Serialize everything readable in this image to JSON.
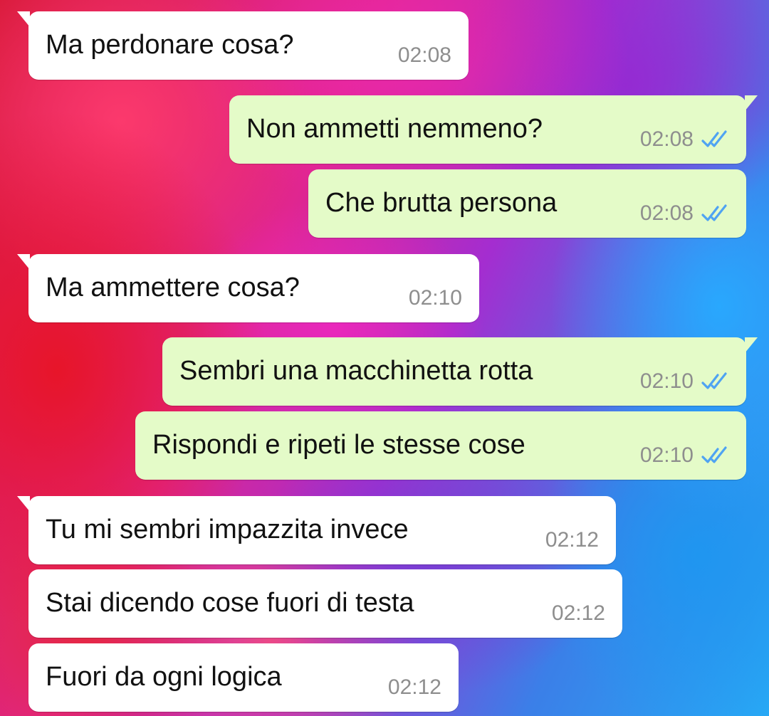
{
  "colors": {
    "incoming_bubble": "#ffffff",
    "outgoing_bubble": "#e4fbc8",
    "message_text": "#111111",
    "timestamp_text": "#8e8e8e",
    "read_receipt": "#4fa3f2"
  },
  "messages": [
    {
      "direction": "incoming",
      "text": "Ma perdonare cosa?",
      "time": "02:08"
    },
    {
      "direction": "outgoing",
      "text": "Non ammetti nemmeno?",
      "time": "02:08",
      "status_icon": "double-check-read-icon"
    },
    {
      "direction": "outgoing",
      "text": "Che brutta persona",
      "time": "02:08",
      "status_icon": "double-check-read-icon"
    },
    {
      "direction": "incoming",
      "text": "Ma ammettere cosa?",
      "time": "02:10"
    },
    {
      "direction": "outgoing",
      "text": "Sembri una macchinetta rotta",
      "time": "02:10",
      "status_icon": "double-check-read-icon"
    },
    {
      "direction": "outgoing",
      "text": "Rispondi e ripeti le stesse cose",
      "time": "02:10",
      "status_icon": "double-check-read-icon"
    },
    {
      "direction": "incoming",
      "text": "Tu mi sembri impazzita invece",
      "time": "02:12"
    },
    {
      "direction": "incoming",
      "text": "Stai dicendo cose fuori di testa",
      "time": "02:12"
    },
    {
      "direction": "incoming",
      "text": "Fuori da ogni logica",
      "time": "02:12"
    }
  ]
}
